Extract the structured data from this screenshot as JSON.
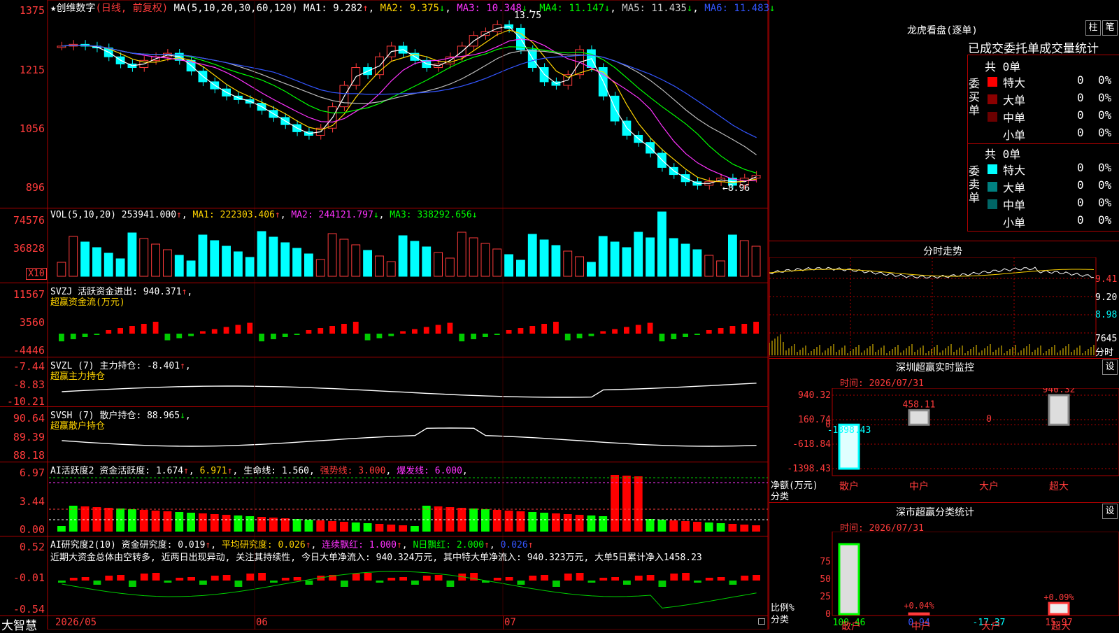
{
  "main": {
    "title_star": "★",
    "stock": "创维数字",
    "period": "(日线, 前复权)",
    "ma_label": "MA(5,10,20,30,60,120)",
    "ma1": "MA1: 9.282",
    "ma2": "MA2: 9.375",
    "ma3": "MA3: 10.348",
    "ma4": "MA4: 11.147",
    "ma5": "MA5: 11.435",
    "ma6": "MA6: 11.483",
    "high_label": "13.75",
    "low_label": "←8.96",
    "y_ticks": [
      "1375",
      "1215",
      "1056",
      "896"
    ]
  },
  "vol": {
    "label": "VOL(5,10,20)",
    "value": "253941.000",
    "ma1": "MA1: 222303.406",
    "ma2": "MA2: 244121.797",
    "ma3": "MA3: 338292.656",
    "y_ticks": [
      "74576",
      "36828"
    ],
    "unit": "X10"
  },
  "svzj": {
    "label": "SVZJ  活跃资金进出: 940.371",
    "sub": "超赢资金流(万元)",
    "y_ticks": [
      "11567",
      "3560",
      "-4446"
    ]
  },
  "svzl": {
    "label": "SVZL (7) 主力持仓: -8.401",
    "sub": "超赢主力持仓",
    "y_ticks": [
      "-7.44",
      "-8.83",
      "-10.21"
    ]
  },
  "svsh": {
    "label": "SVSH (7) 散户持仓: 88.965",
    "sub": "超赢散户持仓",
    "y_ticks": [
      "90.64",
      "89.39",
      "88.18"
    ]
  },
  "ai1": {
    "label": "AI活跃度2 资金活跃度: 1.674",
    "v2": "6.971",
    "life": "生命线: 1.560",
    "strong": "强势线: 3.000",
    "burst": "爆发线: 6.000",
    "y_ticks": [
      "6.97",
      "3.44",
      "0.00"
    ]
  },
  "ai2": {
    "label": "AI研究度2(10) 资金研究度: 0.019",
    "avg": "平均研究度: 0.026",
    "cont": "连续飘红: 1.000",
    "nday": "N日飘红: 2.000",
    "v5": "0.026",
    "comment": "近期大资金总体由空转多, 近两日出现异动, 关注其持续性, 今日大单净流入: 940.324万元, 其中特大单净流入: 940.323万元, 大单5日累计净入1458.23",
    "y_ticks": [
      "0.52",
      "-0.01",
      "-0.54"
    ]
  },
  "xaxis": {
    "brand": "大智慧",
    "dates": [
      "2026/05",
      "06",
      "07"
    ]
  },
  "right": {
    "dragon_title": "龙虎看盘(逐单)",
    "btn1": "柱",
    "btn2": "笔",
    "stats_title": "已成交委托单成交量统计",
    "buy_group": "委买单",
    "sell_group": "委卖单",
    "buy_total": "共 0单",
    "sell_total": "共 0单",
    "rows": [
      {
        "name": "特大",
        "count": "0",
        "pct": "0%"
      },
      {
        "name": "大单",
        "count": "0",
        "pct": "0%"
      },
      {
        "name": "中单",
        "count": "0",
        "pct": "0%"
      },
      {
        "name": "小单",
        "count": "0",
        "pct": "0%"
      }
    ],
    "intraday_title": "分时走势",
    "intraday_prices": [
      "9.41",
      "9.20",
      "8.98"
    ],
    "intraday_vol": "7645",
    "intraday_vol_label": "分时",
    "monitor_title": "深圳超赢实时监控",
    "monitor_btn": "设",
    "monitor_time": "时间: 2026/07/31",
    "monitor_y": [
      "940.32",
      "160.74",
      "0",
      "-618.84",
      "-1398.43"
    ],
    "monitor_axis_label": "净额(万元)",
    "monitor_cat_label": "分类",
    "categories": [
      "散户",
      "中户",
      "大户",
      "超大"
    ],
    "stats2_title": "深市超赢分类统计",
    "stats2_btn": "设",
    "stats2_time": "时间: 2026/07/31",
    "stats2_y": [
      "75",
      "50",
      "25",
      "0"
    ],
    "stats2_axis": "比例%",
    "stats2_cat": "分类"
  },
  "chart_data": {
    "type": "bar",
    "title": "深圳超赢实时监控",
    "categories": [
      "散户",
      "中户",
      "大户",
      "超大"
    ],
    "series": [
      {
        "name": "净额(万元)",
        "values": [
          -1398.43,
          458.11,
          0,
          940.32
        ]
      },
      {
        "name": "比例%",
        "values": [
          100.46,
          0.94,
          -17.37,
          15.97
        ]
      }
    ],
    "bar_labels": [
      "-1398.43",
      "458.11",
      "0",
      "940.32"
    ],
    "ratio_labels": [
      "100.46",
      "0.94",
      "-17.37",
      "15.97"
    ],
    "ratio_annotations": [
      "+0.04%",
      "+0.09%"
    ],
    "ylim": [
      -1398.43,
      940.32
    ]
  }
}
